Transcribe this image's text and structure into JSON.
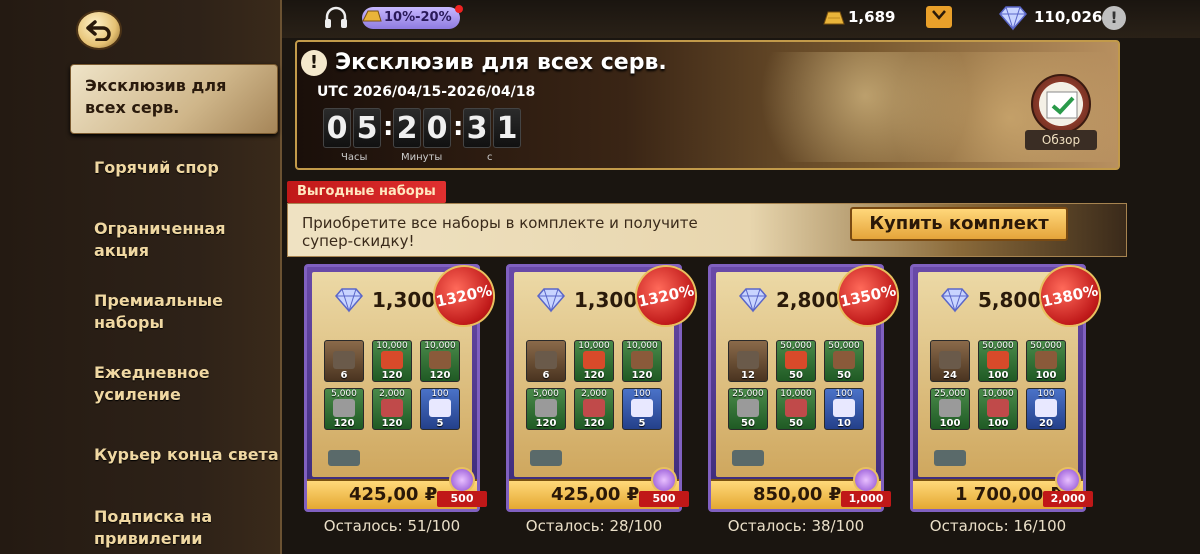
{
  "sidebar": {
    "active": "Эксклюзив для всех серв.",
    "items": [
      "Горячий спор",
      "Ограниченная акция",
      "Премиальные наборы",
      "Ежедневное усиление",
      "Курьер конца света",
      "Подписка на привилегии"
    ]
  },
  "topbar": {
    "promo": "10%-20%",
    "gold": "1,689",
    "diamonds": "110,026"
  },
  "banner": {
    "title": "Эксклюзив для всех серв.",
    "date": "UTC 2026/04/15-2026/04/18",
    "timer": {
      "h1": "0",
      "h2": "5",
      "m1": "2",
      "m2": "0",
      "s1": "3",
      "s2": "1"
    },
    "labels": {
      "hours": "Часы",
      "minutes": "Минуты",
      "seconds": "с"
    },
    "overview": "Обзор"
  },
  "bundle": {
    "tag": "Выгодные наборы",
    "text": "Приобретите все наборы в комплекте и получите супер-скидку!",
    "buy_all": "Купить комплект"
  },
  "cards": [
    {
      "diamonds": "1,300",
      "bonus": "1320%",
      "price": "425,00 ₽",
      "points": "500",
      "remain": "Осталось: 51/100",
      "items": [
        {
          "t": "",
          "b": "6"
        },
        {
          "t": "10,000",
          "b": "120"
        },
        {
          "t": "10,000",
          "b": "120"
        },
        {
          "t": "5,000",
          "b": "120"
        },
        {
          "t": "2,000",
          "b": "120"
        },
        {
          "t": "100",
          "b": "5"
        }
      ]
    },
    {
      "diamonds": "1,300",
      "bonus": "1320%",
      "price": "425,00 ₽",
      "points": "500",
      "remain": "Осталось: 28/100",
      "items": [
        {
          "t": "",
          "b": "6"
        },
        {
          "t": "10,000",
          "b": "120"
        },
        {
          "t": "10,000",
          "b": "120"
        },
        {
          "t": "5,000",
          "b": "120"
        },
        {
          "t": "2,000",
          "b": "120"
        },
        {
          "t": "100",
          "b": "5"
        }
      ]
    },
    {
      "diamonds": "2,800",
      "bonus": "1350%",
      "price": "850,00 ₽",
      "points": "1,000",
      "remain": "Осталось: 38/100",
      "items": [
        {
          "t": "",
          "b": "12"
        },
        {
          "t": "50,000",
          "b": "50"
        },
        {
          "t": "50,000",
          "b": "50"
        },
        {
          "t": "25,000",
          "b": "50"
        },
        {
          "t": "10,000",
          "b": "50"
        },
        {
          "t": "100",
          "b": "10"
        }
      ]
    },
    {
      "diamonds": "5,800",
      "bonus": "1380%",
      "price": "1 700,00 ₽",
      "points": "2,000",
      "remain": "Осталось: 16/100",
      "items": [
        {
          "t": "",
          "b": "24"
        },
        {
          "t": "50,000",
          "b": "100"
        },
        {
          "t": "50,000",
          "b": "100"
        },
        {
          "t": "25,000",
          "b": "100"
        },
        {
          "t": "10,000",
          "b": "100"
        },
        {
          "t": "100",
          "b": "20"
        }
      ]
    }
  ]
}
